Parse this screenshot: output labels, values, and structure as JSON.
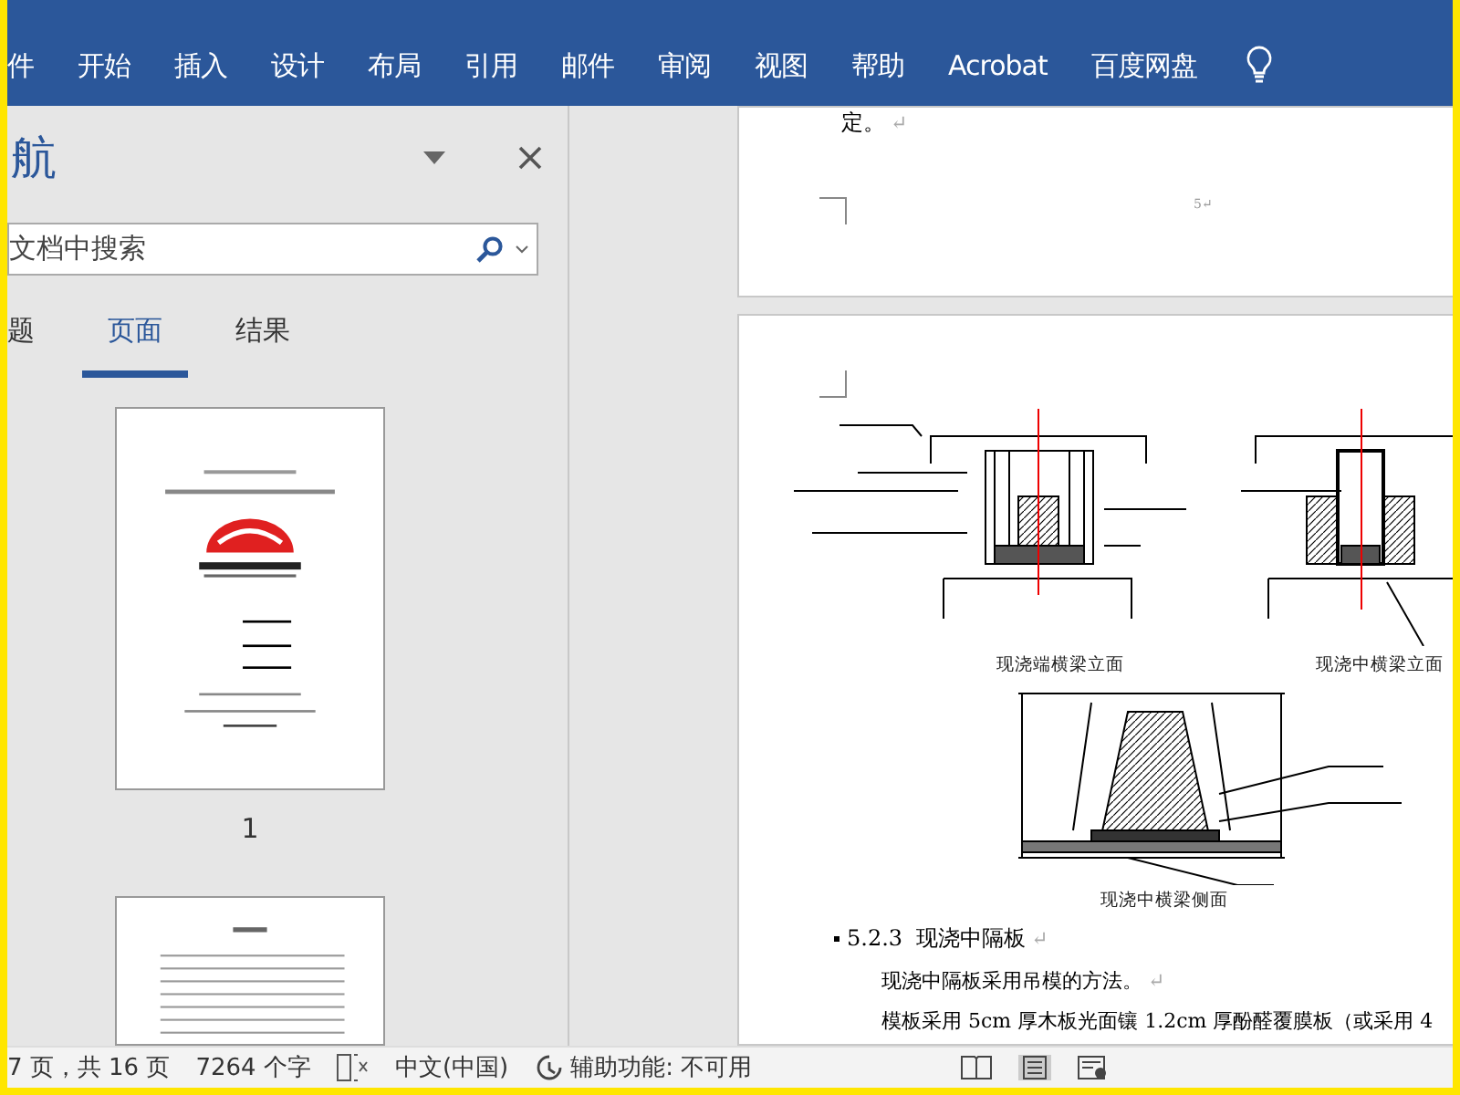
{
  "ribbon": {
    "tabs": [
      {
        "label": "件",
        "selected": false
      },
      {
        "label": "开始",
        "selected": false
      },
      {
        "label": "插入",
        "selected": false
      },
      {
        "label": "设计",
        "selected": false
      },
      {
        "label": "布局",
        "selected": false
      },
      {
        "label": "引用",
        "selected": false
      },
      {
        "label": "邮件",
        "selected": false
      },
      {
        "label": "审阅",
        "selected": false
      },
      {
        "label": "视图",
        "selected": false
      },
      {
        "label": "帮助",
        "selected": false
      },
      {
        "label": "Acrobat",
        "selected": false
      },
      {
        "label": "百度网盘",
        "selected": false
      }
    ]
  },
  "navigation": {
    "title": "航",
    "search": {
      "placeholder": "文档中搜索"
    },
    "tabs": [
      {
        "label": "题",
        "selected": false
      },
      {
        "label": "页面",
        "selected": true
      },
      {
        "label": "结果",
        "selected": false
      }
    ],
    "thumbnails": [
      {
        "page_label": "1",
        "kind": "cover"
      },
      {
        "kind": "toc"
      }
    ]
  },
  "document": {
    "page_end": {
      "text": "定。",
      "mark": "↵",
      "page_number": "5↵"
    },
    "captions": [
      {
        "text": "现浇端横梁立面"
      },
      {
        "text": "现浇中横梁立面"
      },
      {
        "text": "现浇中横梁侧面"
      }
    ],
    "heading": {
      "number": "5.2.3",
      "text": "现浇中隔板",
      "mark": "↵"
    },
    "paragraphs": [
      {
        "text": "现浇中隔板采用吊模的方法。",
        "mark": "↵"
      },
      {
        "text": "模板采用 5cm 厚木板光面镶 1.2cm 厚酚醛覆膜板（或采用 4"
      }
    ]
  },
  "status_bar": {
    "page": "7 页，共 16 页",
    "words": "7264 个字",
    "language": "中文(中国)",
    "accessibility": "辅助功能: 不可用"
  }
}
